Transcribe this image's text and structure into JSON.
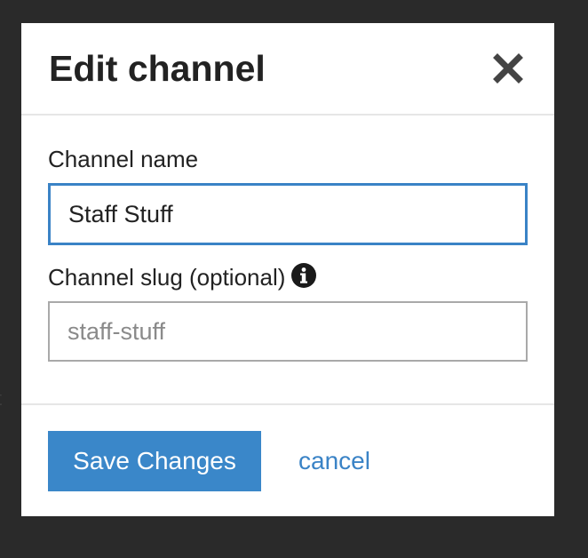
{
  "background": {
    "color": "#2a2a2a",
    "partial_text": "t"
  },
  "modal": {
    "title": "Edit channel",
    "close_icon": "close-icon",
    "fields": {
      "channel_name": {
        "label": "Channel name",
        "value": "Staff Stuff"
      },
      "channel_slug": {
        "label": "Channel slug (optional)",
        "info_icon": "info-icon",
        "value": "",
        "placeholder": "staff-stuff"
      }
    },
    "footer": {
      "save_label": "Save Changes",
      "cancel_label": "cancel"
    }
  },
  "colors": {
    "accent": "#3a87c9",
    "focus_border": "#3a83c6",
    "link": "#3a83c6",
    "title_text": "#222222"
  }
}
